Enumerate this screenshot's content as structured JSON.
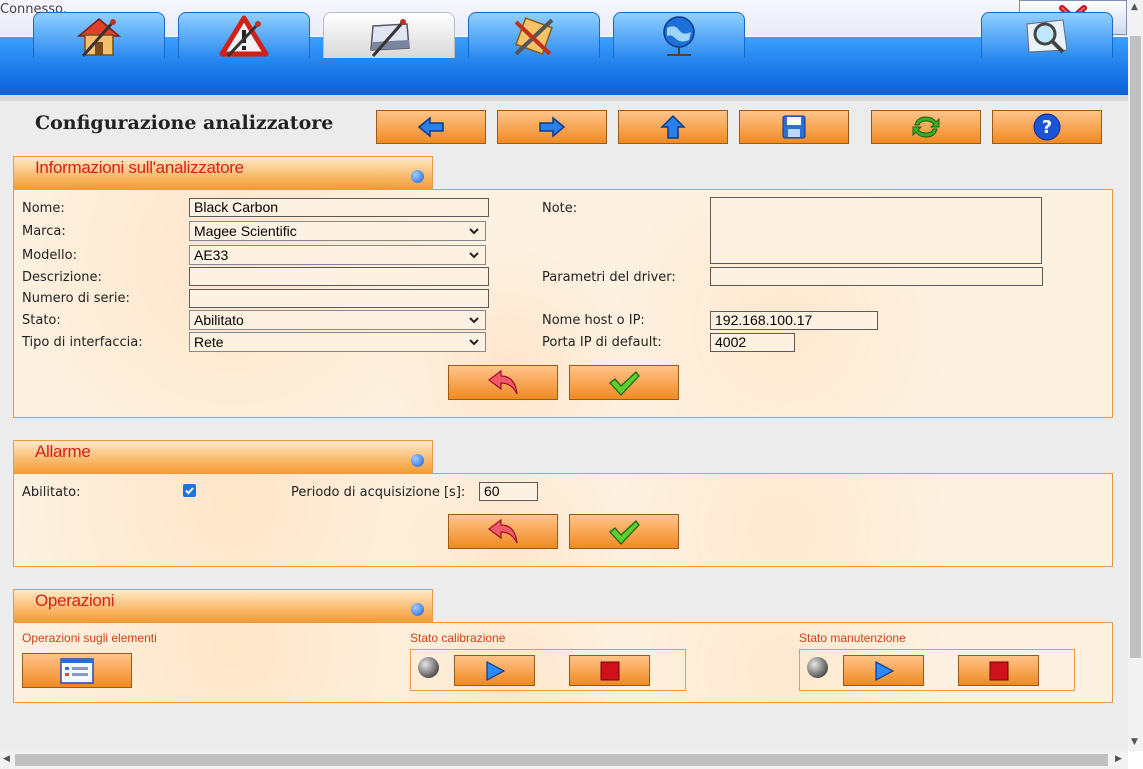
{
  "status": {
    "text": "Connesso."
  },
  "tabs": [
    {
      "icon": "home-icon"
    },
    {
      "icon": "warning-icon"
    },
    {
      "icon": "config-icon",
      "active": true
    },
    {
      "icon": "tools-icon"
    },
    {
      "icon": "network-icon"
    },
    {
      "icon": "search-icon"
    }
  ],
  "header": {
    "title": "Configurazione analizzatore"
  },
  "toolbar": {
    "back_icon": "arrow-left-icon",
    "forward_icon": "arrow-right-icon",
    "up_icon": "arrow-up-icon",
    "save_icon": "floppy-icon",
    "refresh_icon": "refresh-icon",
    "help_icon": "help-icon"
  },
  "info_panel": {
    "title": "Informazioni sull'analizzatore",
    "nome_label": "Nome:",
    "nome_value": "Black Carbon",
    "marca_label": "Marca:",
    "marca_value": "Magee Scientific",
    "modello_label": "Modello:",
    "modello_value": "AE33",
    "descrizione_label": "Descrizione:",
    "descrizione_value": "",
    "serie_label": "Numero di serie:",
    "serie_value": "",
    "stato_label": "Stato:",
    "stato_value": "Abilitato",
    "interfaccia_label": "Tipo di interfaccia:",
    "interfaccia_value": "Rete",
    "note_label": "Note:",
    "note_value": "",
    "driver_label": "Parametri del driver:",
    "driver_value": "",
    "host_label": "Nome host o IP:",
    "host_value": "192.168.100.17",
    "porta_label": "Porta IP di default:",
    "porta_value": "4002"
  },
  "alarm_panel": {
    "title": "Allarme",
    "abilitato_label": "Abilitato:",
    "abilitato_checked": true,
    "periodo_label": "Periodo di acquisizione [s]:",
    "periodo_value": "60"
  },
  "ops_panel": {
    "title": "Operazioni",
    "elementi_label": "Operazioni sugli elementi",
    "calibrazione_label": "Stato calibrazione",
    "manutenzione_label": "Stato manutenzione"
  },
  "colors": {
    "accent": "#f08a22",
    "panel_title": "#d8201a",
    "tabbar": "#0a5fd8",
    "panel_bg": "#fdf1e1"
  }
}
